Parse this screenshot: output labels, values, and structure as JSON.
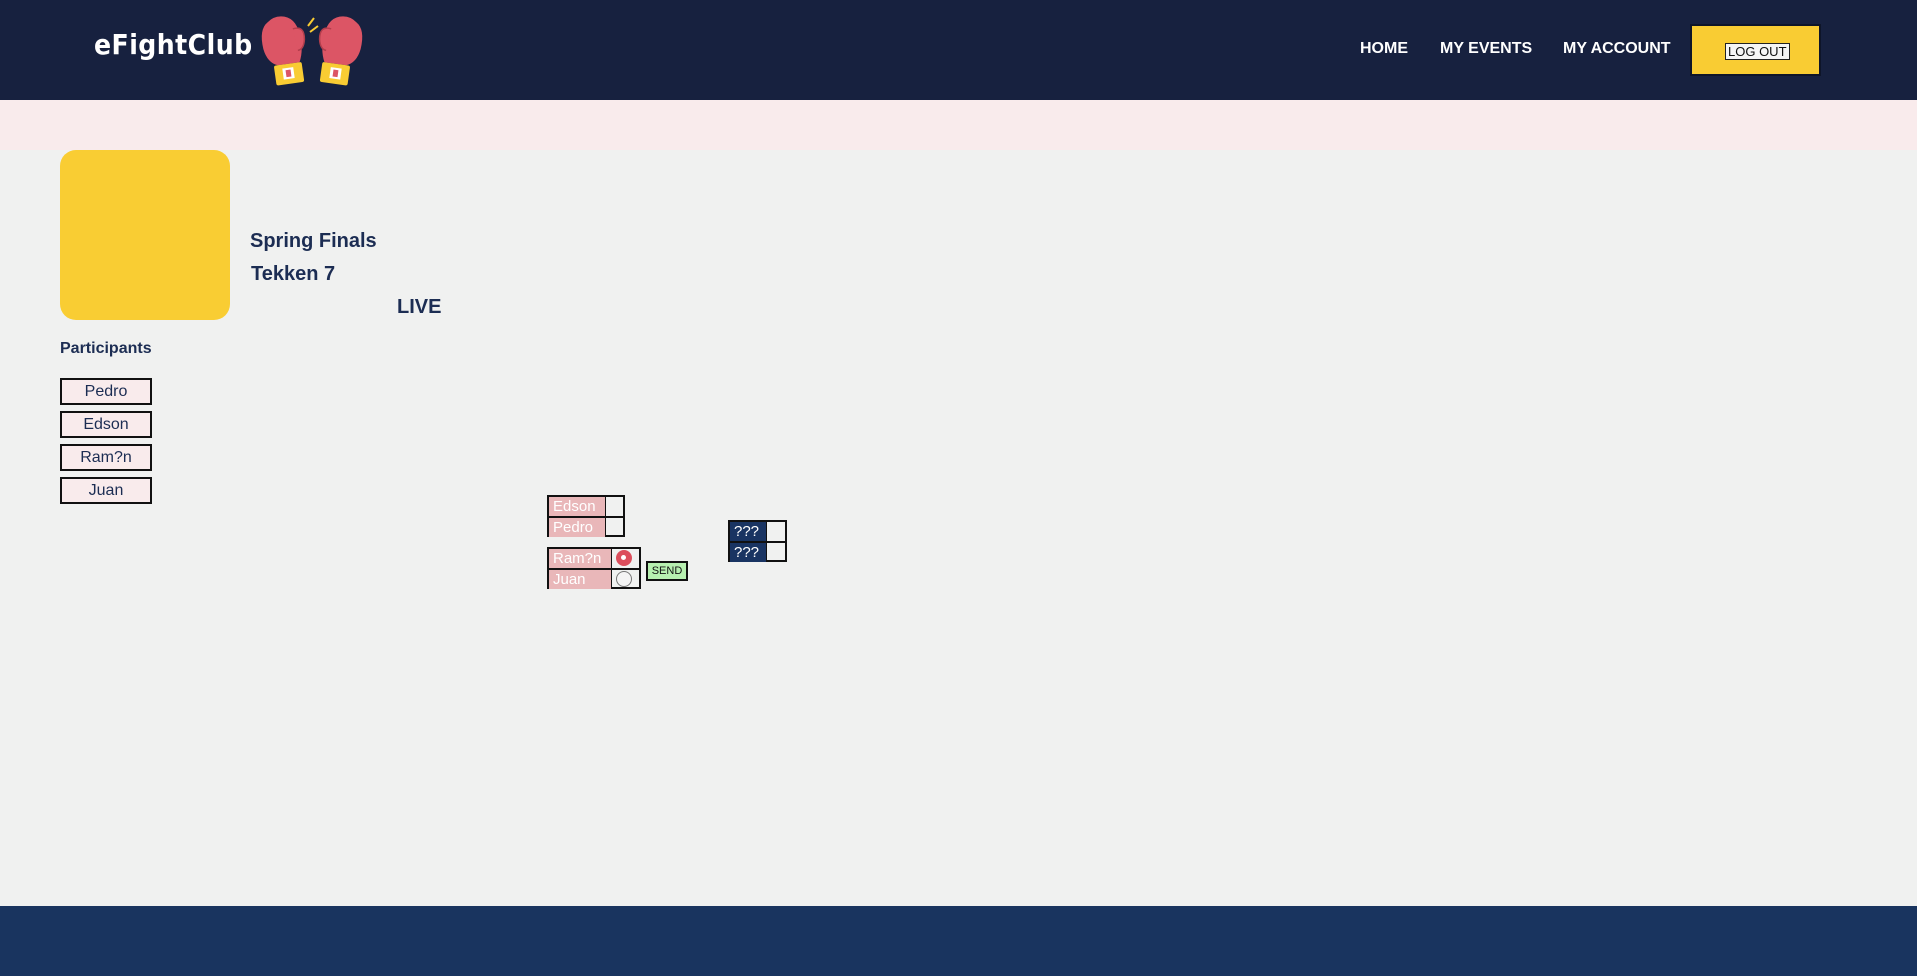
{
  "header": {
    "logo_text": "eFightClub",
    "logo_icon": "boxing-gloves-icon",
    "nav": {
      "home": "HOME",
      "events": "MY EVENTS",
      "account": "MY ACCOUNT"
    },
    "logout_label": "LOG OUT"
  },
  "event": {
    "name": "Spring Finals",
    "game": "Tekken 7",
    "status": "LIVE"
  },
  "participants": {
    "title": "Participants",
    "list": [
      "Pedro",
      "Edson",
      "Ram?n",
      "Juan"
    ]
  },
  "bracket": {
    "match1": {
      "player1": "Edson",
      "player2": "Pedro"
    },
    "match2": {
      "player1": "Ram?n",
      "player2": "Juan",
      "selected": "Ram?n"
    },
    "final": {
      "player1": "???",
      "player2": "???"
    },
    "send_label": "SEND"
  },
  "colors": {
    "header_bg": "#17213f",
    "accent_yellow": "#f9cc33",
    "pink_band": "#f9ebec",
    "slot_pink": "#e9b7b9",
    "slot_navy": "#193462",
    "radio_red": "#dc4e5c",
    "send_green": "#b7f0b0",
    "footer_bg": "#19345f"
  }
}
